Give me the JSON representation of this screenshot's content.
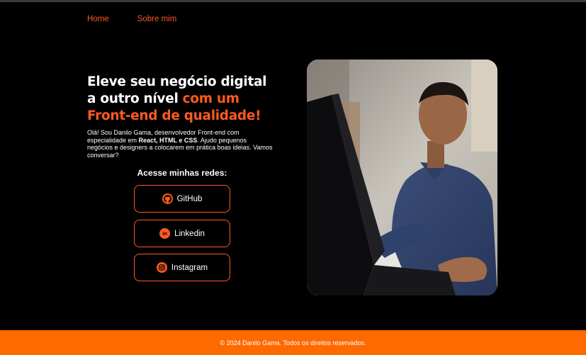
{
  "nav": {
    "home": "Home",
    "about": "Sobre mim"
  },
  "hero": {
    "headline_part1": "Eleve seu negócio digital a outro nível ",
    "headline_accent": "com um Front-end de qualidade!",
    "intro_1": "Olá! Sou Danilo Gama, desenvolvedor Front-end com especialidade em ",
    "intro_bold": "React, HTML e CSS",
    "intro_2": ". Ajudo pequenos negócios e designers a colocarem em prática boas ideias. Vamos conversar?"
  },
  "social": {
    "title": "Acesse minhas redes:",
    "github": "GitHub",
    "linkedin": "Linkedin",
    "instagram": "Instagram",
    "accent_color": "#ff5a1f"
  },
  "footer": {
    "text": "© 2024 Danilo Gama. Todos os direitos reservados."
  }
}
